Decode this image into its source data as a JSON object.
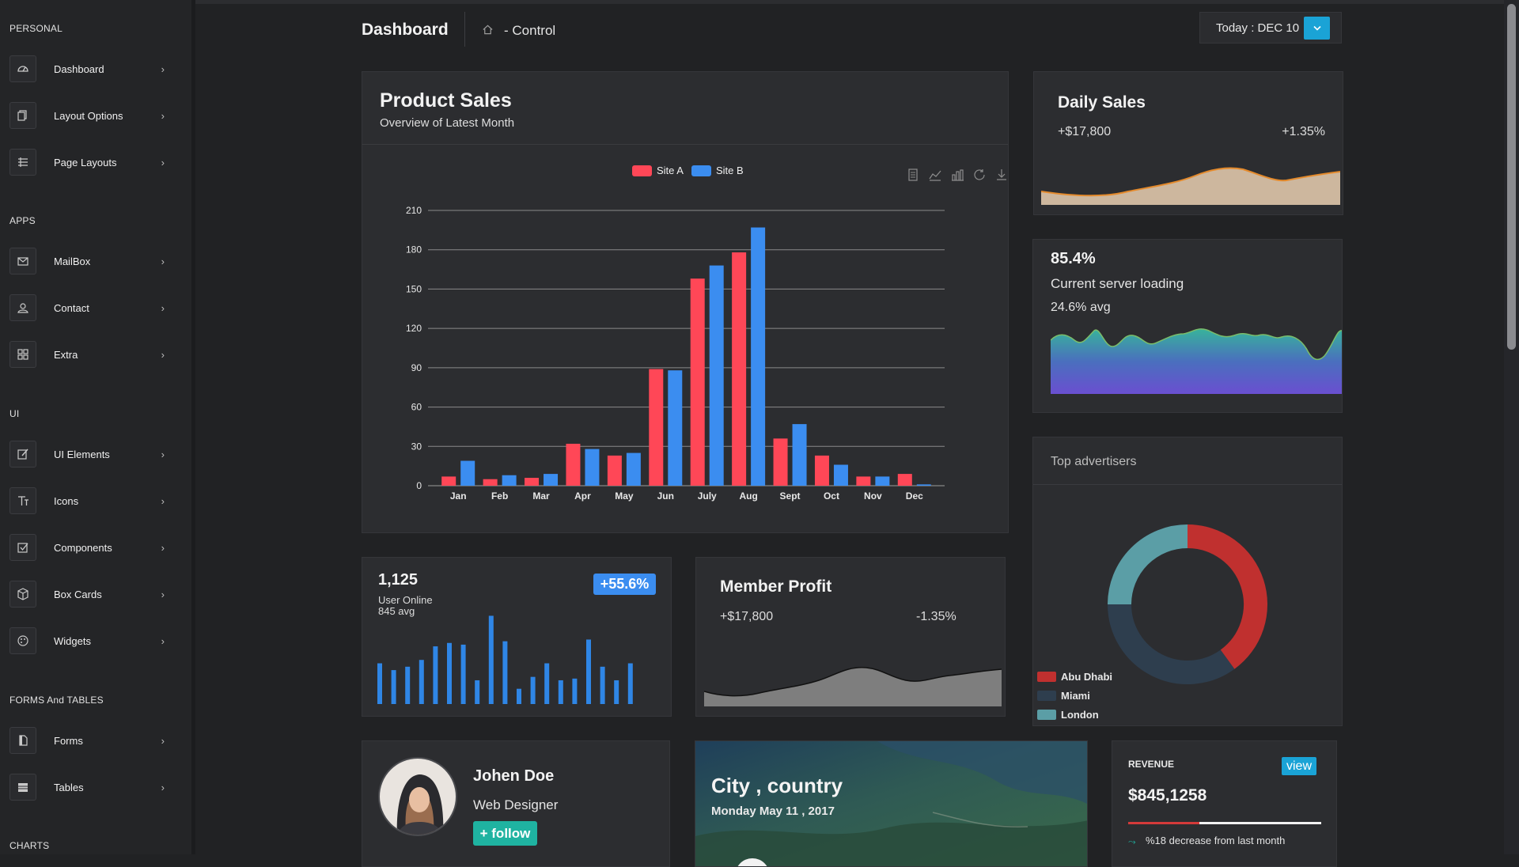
{
  "sidebar": {
    "sections": [
      {
        "title": "PERSONAL",
        "items": [
          {
            "label": "Dashboard",
            "icon": "gauge-icon"
          },
          {
            "label": "Layout Options",
            "icon": "copy-icon"
          },
          {
            "label": "Page Layouts",
            "icon": "layers-icon"
          }
        ]
      },
      {
        "title": "APPS",
        "items": [
          {
            "label": "MailBox",
            "icon": "mail-icon"
          },
          {
            "label": "Contact",
            "icon": "user-icon"
          },
          {
            "label": "Extra",
            "icon": "grid-icon"
          }
        ]
      },
      {
        "title": "UI",
        "items": [
          {
            "label": "UI Elements",
            "icon": "edit-icon"
          },
          {
            "label": "Icons",
            "icon": "text-icon"
          },
          {
            "label": "Components",
            "icon": "checkbox-icon"
          },
          {
            "label": "Box Cards",
            "icon": "box-icon"
          },
          {
            "label": "Widgets",
            "icon": "palette-icon"
          }
        ]
      },
      {
        "title": "FORMS And TABLES",
        "items": [
          {
            "label": "Forms",
            "icon": "file-icon"
          },
          {
            "label": "Tables",
            "icon": "table-icon"
          }
        ]
      },
      {
        "title": "CHARTS",
        "items": []
      }
    ]
  },
  "header": {
    "title": "Dashboard",
    "breadcrumb": "- Control",
    "date_label": "Today : DEC 10",
    "date_button_icon": "chevron-down-icon"
  },
  "product_sales": {
    "title": "Product Sales",
    "subtitle": "Overview of Latest Month",
    "colors": {
      "site_a": "#ff4757",
      "site_b": "#3b8df0"
    }
  },
  "chart_data": [
    {
      "type": "bar",
      "categories": [
        "Jan",
        "Feb",
        "Mar",
        "Apr",
        "May",
        "Jun",
        "July",
        "Aug",
        "Sept",
        "Oct",
        "Nov",
        "Dec"
      ],
      "series": [
        {
          "name": "Site A",
          "values": [
            7,
            5,
            6,
            32,
            23,
            89,
            158,
            178,
            36,
            23,
            7,
            9
          ]
        },
        {
          "name": "Site B",
          "values": [
            19,
            8,
            9,
            28,
            25,
            88,
            168,
            197,
            47,
            16,
            7,
            1
          ]
        }
      ],
      "y_ticks": [
        0,
        30,
        60,
        90,
        120,
        150,
        180,
        210
      ],
      "ylim": [
        0,
        210
      ],
      "grid": true,
      "legend": "top-center"
    },
    {
      "type": "pie",
      "categories": [
        "Abu Dhabi",
        "Miami",
        "London"
      ],
      "values": [
        40,
        35,
        25
      ],
      "colors": [
        "#c0302f",
        "#2e3e4e",
        "#5b9ea6"
      ],
      "legend": "bottom-left"
    },
    {
      "type": "bar",
      "values": [
        24,
        20,
        22,
        26,
        34,
        36,
        35,
        14,
        52,
        37,
        9,
        16,
        24,
        14,
        15,
        38,
        22,
        14,
        24
      ],
      "ylim": [
        0,
        55
      ]
    }
  ],
  "daily_sales": {
    "title": "Daily Sales",
    "amount": "+$17,800",
    "change": "+1.35%"
  },
  "server": {
    "percent": "85.4%",
    "label": "Current server loading",
    "avg": "24.6% avg"
  },
  "advertisers": {
    "title": "Top advertisers",
    "legend": [
      {
        "name": "Abu Dhabi",
        "color": "#c0302f"
      },
      {
        "name": "Miami",
        "color": "#2e3e4e"
      },
      {
        "name": "London",
        "color": "#5b9ea6"
      }
    ]
  },
  "users": {
    "count": "1,125",
    "label": "User Online",
    "avg": "845 avg",
    "badge": "+55.6%"
  },
  "member_profit": {
    "title": "Member Profit",
    "amount": "+$17,800",
    "change": "-1.35%"
  },
  "profile": {
    "name": "Johen Doe",
    "role": "Web Designer",
    "follow_label": "+ follow"
  },
  "city": {
    "title": "City , country",
    "date": "Monday May 11 , 2017"
  },
  "revenue": {
    "label": "REVENUE",
    "view_label": "view",
    "amount": "$845,1258",
    "note": "%18 decrease from last month",
    "progress": 0.37
  }
}
